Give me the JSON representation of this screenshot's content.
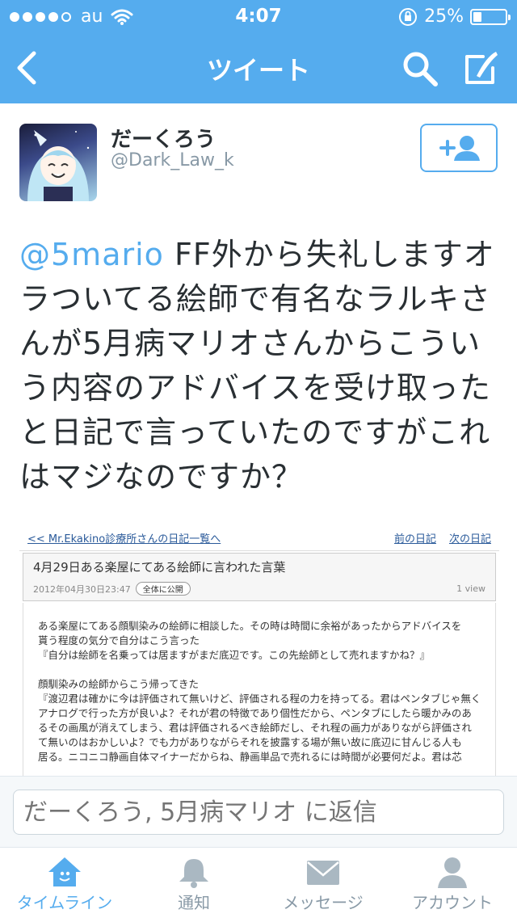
{
  "status_bar": {
    "carrier": "au",
    "time": "4:07",
    "battery": "25%",
    "battery_level": 0.25
  },
  "nav": {
    "title": "ツイート"
  },
  "tweet": {
    "name": "だーくろう",
    "handle": "@Dark_Law_k",
    "mention": "@5mario",
    "text": " FF外から失礼しますオラついてる絵師で有名なラルキさんが5月病マリオさんからこういう内容のアドバイスを受け取ったと日記で言っていたのですがこれはマジなのですか？"
  },
  "embed": {
    "back_link": "<< Mr.Ekakino診療所さんの日記一覧へ",
    "prev_link": "前の日記",
    "next_link": "次の日記",
    "title": "4月29日ある楽屋にてある絵師に言われた言葉",
    "date": "2012年04月30日23:47",
    "visibility": "全体に公開",
    "views": "1 view",
    "lines": [
      "ある楽屋にてある顔馴染みの絵師に相談した。その時は時間に余裕があったからアドバイスを",
      "貰う程度の気分で自分はこう言った",
      "『自分は絵師を名乗っては居ますがまだ底辺です。この先絵師として売れますかね？』",
      "",
      "顔馴染みの絵師からこう帰ってきた",
      "『渡辺君は確かに今は評価されて無いけど、評価される程の力を持ってる。君はペンタブじゃ無く",
      "アナログで行った方が良いよ？それが君の特徴であり個性だから、ペンタブにしたら暖かみのあ",
      "るその画風が消えてしまう、君は評価されるべき絵師だし、それ程の画力がありながら評価され",
      "て無いのはおかしいよ？でも力がありながらそれを披露する場が無い故に底辺に甘んじる人も",
      "居る。ニコニコ静画自体マイナーだからね、静画単品で売れるには時間が必要何だよ。君は芯"
    ]
  },
  "reply": {
    "placeholder": "だーくろう, 5月病マリオ に返信"
  },
  "tabs": [
    {
      "label": "タイムライン",
      "icon": "home-icon",
      "active": true
    },
    {
      "label": "通知",
      "icon": "bell-icon",
      "active": false
    },
    {
      "label": "メッセージ",
      "icon": "envelope-icon",
      "active": false
    },
    {
      "label": "アカウント",
      "icon": "person-icon",
      "active": false
    }
  ],
  "colors": {
    "accent": "#55acee",
    "muted": "#8899a6",
    "text": "#292f33"
  }
}
